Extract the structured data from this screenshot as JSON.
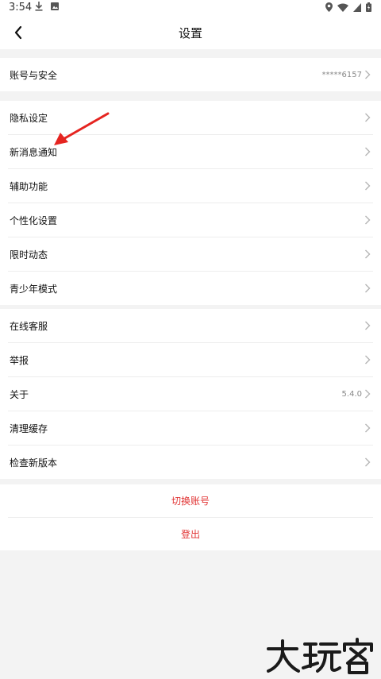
{
  "status_bar": {
    "time": "3:54",
    "left_icons": [
      "download-icon",
      "image-notification-icon"
    ],
    "right_icons": [
      "location-icon",
      "wifi-icon",
      "cell-signal-icon",
      "battery-charging-icon"
    ]
  },
  "header": {
    "title": "设置",
    "back_icon": "chevron-left-icon"
  },
  "groups": [
    {
      "items": [
        {
          "label": "账号与安全",
          "value": "*****6157"
        }
      ]
    },
    {
      "items": [
        {
          "label": "隐私设定"
        },
        {
          "label": "新消息通知"
        },
        {
          "label": "辅助功能"
        },
        {
          "label": "个性化设置"
        },
        {
          "label": "限时动态"
        },
        {
          "label": "青少年模式"
        }
      ]
    },
    {
      "items": [
        {
          "label": "在线客服"
        },
        {
          "label": "举报"
        },
        {
          "label": "关于",
          "value": "5.4.0"
        },
        {
          "label": "清理缓存"
        },
        {
          "label": "检查新版本"
        }
      ]
    }
  ],
  "actions": {
    "switch_account": "切换账号",
    "logout": "登出"
  },
  "colors": {
    "accent_red": "#e13333",
    "background": "#f3f3f3",
    "annotation_arrow": "#e52420"
  },
  "watermark": {
    "logo_text": "大玩家"
  }
}
